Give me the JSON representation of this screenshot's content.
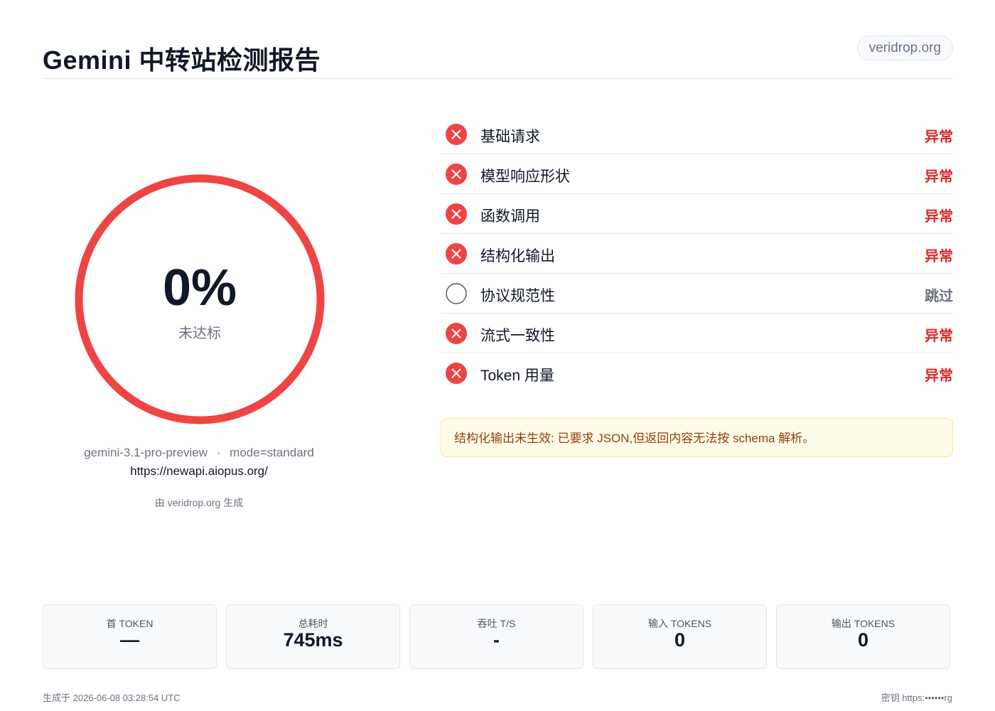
{
  "header": {
    "title": "Gemini 中转站检测报告",
    "site_badge": "veridrop.org"
  },
  "score": {
    "value": "0%",
    "status": "未达标",
    "fraction": 0,
    "ring_color": "#ef4444"
  },
  "info": {
    "model": "gemini-3.1-pro-preview",
    "separator": "·",
    "mode": "mode=standard",
    "url": "https://newapi.aiopus.org/",
    "generated_by": "由 veridrop.org 生成"
  },
  "checks": [
    {
      "label": "基础请求",
      "status": "异常",
      "state": "fail",
      "icon": "fail-x-icon"
    },
    {
      "label": "模型响应形状",
      "status": "异常",
      "state": "fail",
      "icon": "fail-x-icon"
    },
    {
      "label": "函数调用",
      "status": "异常",
      "state": "fail",
      "icon": "fail-x-icon"
    },
    {
      "label": "结构化输出",
      "status": "异常",
      "state": "fail",
      "icon": "fail-x-icon"
    },
    {
      "label": "协议规范性",
      "status": "跳过",
      "state": "skip",
      "icon": "skip-circle-icon"
    },
    {
      "label": "流式一致性",
      "status": "异常",
      "state": "fail",
      "icon": "fail-x-icon"
    },
    {
      "label": "Token 用量",
      "status": "异常",
      "state": "fail",
      "icon": "fail-x-icon"
    }
  ],
  "alert": {
    "text": "结构化输出未生效: 已要求 JSON,但返回内容无法按 schema 解析。"
  },
  "metrics": [
    {
      "label": "首 TOKEN",
      "value": "—"
    },
    {
      "label": "总耗时",
      "value": "745ms"
    },
    {
      "label": "吞吐 T/S",
      "value": "-"
    },
    {
      "label": "输入 TOKENS",
      "value": "0"
    },
    {
      "label": "输出 TOKENS",
      "value": "0"
    }
  ],
  "footer": {
    "generated_at": "生成于 2026-06-08 03:28:54 UTC",
    "key": "密钥 https:••••••rg"
  },
  "colors": {
    "fail": "#dc2626",
    "fail_icon": "#ef4444",
    "skip": "#6b7280",
    "alert_bg": "#fefce8",
    "alert_text": "#92400e"
  }
}
